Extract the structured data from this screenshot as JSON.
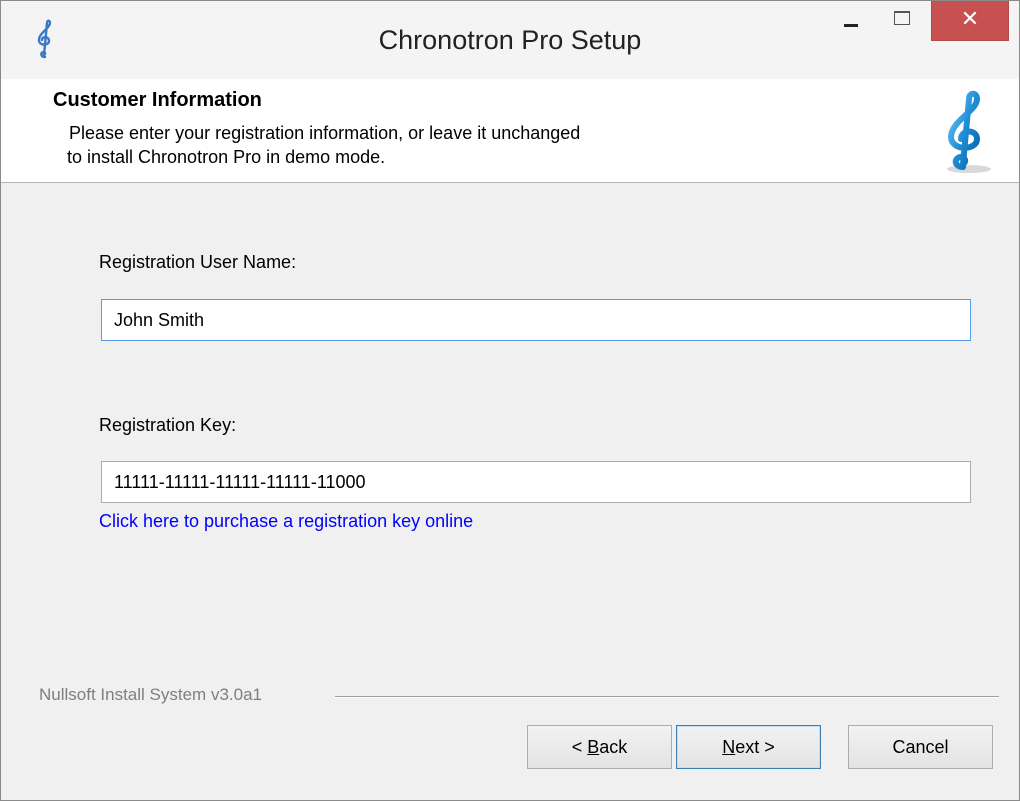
{
  "window": {
    "title": "Chronotron Pro Setup",
    "close_glyph": "✕"
  },
  "header": {
    "title": "Customer Information",
    "subtitle_line1": "Please enter your registration information, or leave it unchanged",
    "subtitle_line2": "to install Chronotron Pro in demo mode.",
    "logo_icon": "treble-clef-icon"
  },
  "form": {
    "username_label": "Registration User Name:",
    "username_value": "John Smith",
    "key_label": "Registration Key:",
    "key_value": "11111-11111-11111-11111-11000",
    "purchase_link": "Click here to purchase a registration key online"
  },
  "footer": {
    "branding": "Nullsoft Install System v3.0a1",
    "back_prefix": "< ",
    "back_mnemonic": "B",
    "back_rest": "ack",
    "next_mnemonic": "N",
    "next_rest": "ext >",
    "cancel_label": "Cancel"
  },
  "colors": {
    "close_button": "#c75050",
    "link": "#0000ff",
    "focus_border": "#569de5",
    "clef_accent": "#1e90d8"
  }
}
